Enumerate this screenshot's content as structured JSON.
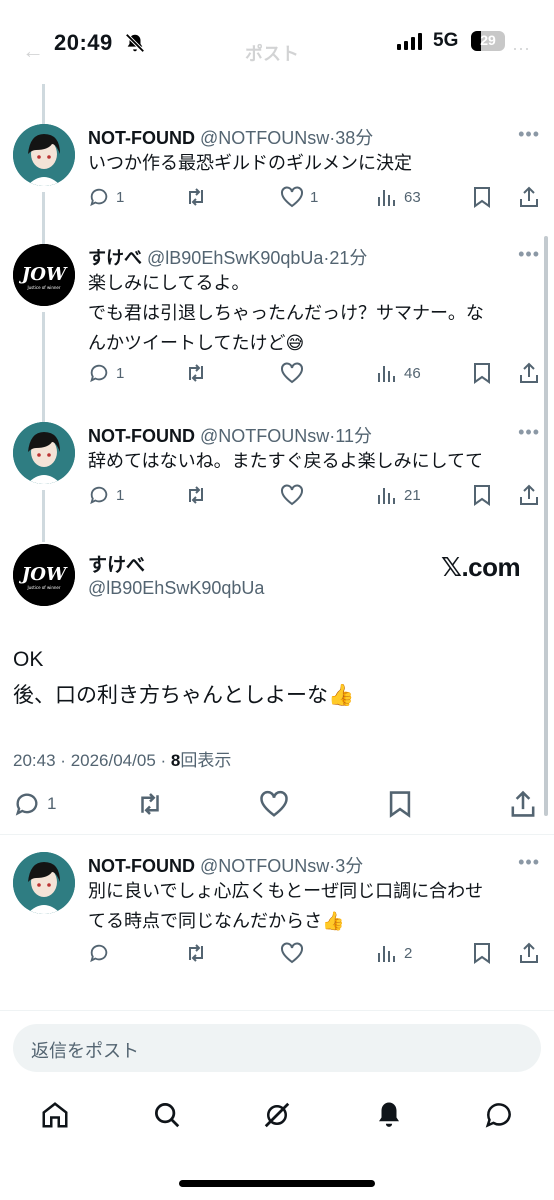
{
  "status_bar": {
    "time": "20:49",
    "network": "5G",
    "battery": "29",
    "battery_level": 0.29
  },
  "nav": {
    "title": "ポスト"
  },
  "tweets": [
    {
      "display_name": "NOT-FOUND",
      "handle": "@NOTFOUNsw",
      "time": "38分",
      "text": [
        "いつか作る最恐ギルドのギルメンに決定"
      ],
      "replies": "1",
      "likes": "1",
      "views": "63"
    },
    {
      "display_name": "すけべ",
      "handle": "@lB90EhSwK90qbUa",
      "time": "21分",
      "text": [
        "楽しみにしてるよ。",
        "でも君は引退しちゃったんだっけ？サマナー。な",
        "んかツイートしてたけど😅"
      ],
      "replies": "1",
      "likes": "",
      "views": "46"
    },
    {
      "display_name": "NOT-FOUND",
      "handle": "@NOTFOUNsw",
      "time": "11分",
      "text": [
        "辞めてはないね。またすぐ戻るよ楽しみにしてて"
      ],
      "replies": "1",
      "likes": "",
      "views": "21"
    }
  ],
  "main_tweet": {
    "display_name": "すけべ",
    "handle": "@lB90EhSwK90qbUa",
    "watermark": "𝕏.com",
    "text": [
      "OK",
      "後、口の利き方ちゃんとしよーな👍"
    ],
    "time": "20:43",
    "date": "2026/04/05",
    "views_count": "8",
    "views_label": "回表示",
    "replies": "1"
  },
  "reply_tweet": {
    "display_name": "NOT-FOUND",
    "handle": "@NOTFOUNsw",
    "time": "3分",
    "text": [
      "別に良いでしょ心広くもとーぜ同じ口調に合わせ",
      "てる時点で同じなんだからさ👍"
    ],
    "replies": "",
    "likes": "",
    "views": "2"
  },
  "reply_box": {
    "placeholder": "返信をポスト"
  },
  "avatars": {
    "jow_logo": "JOW",
    "jow_tagline": "Justice of winner"
  },
  "separator": "·"
}
